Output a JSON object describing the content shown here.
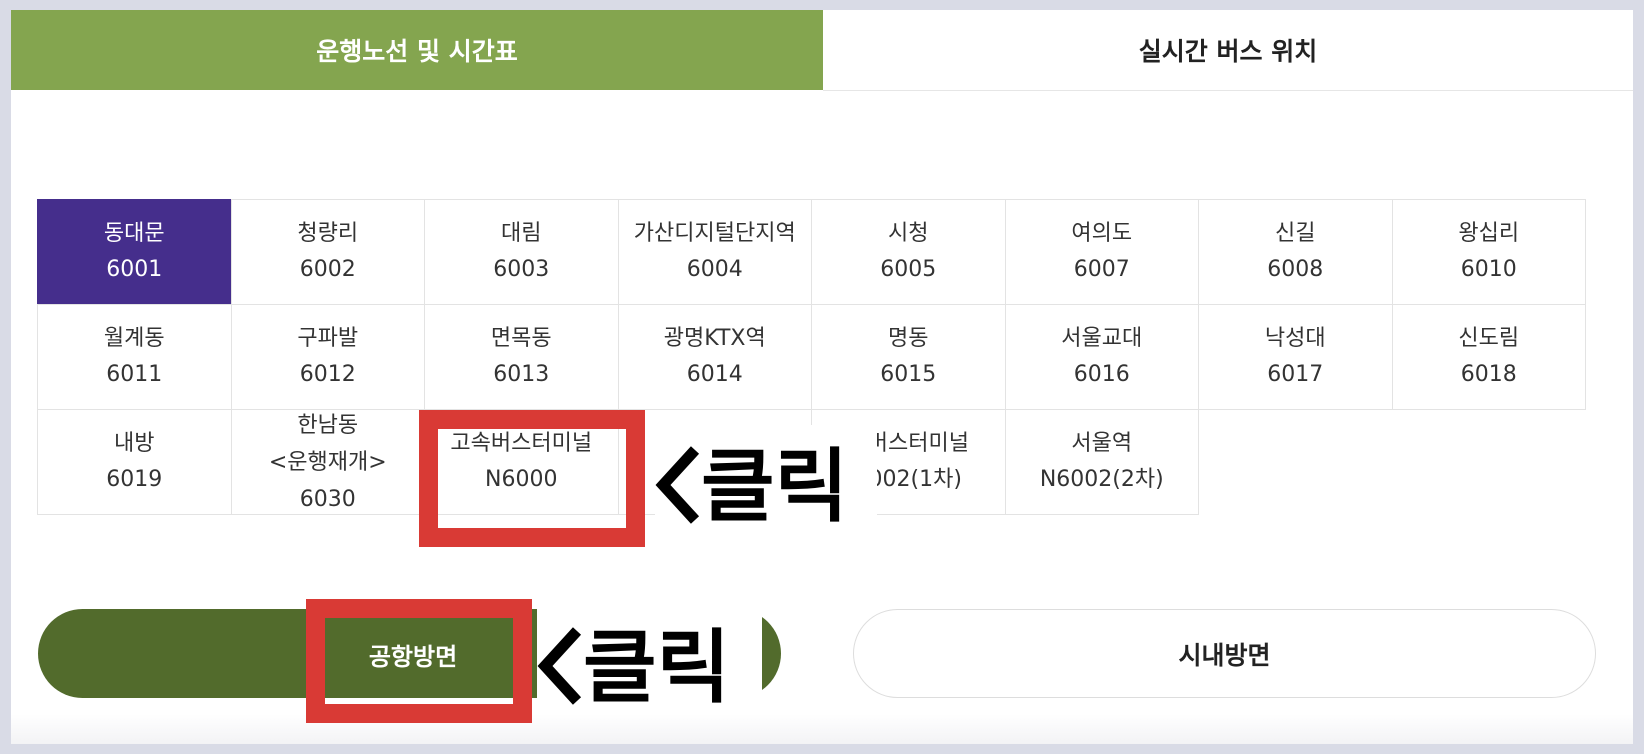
{
  "tabs": [
    {
      "label": "운행노선 및 시간표",
      "active": true
    },
    {
      "label": "실시간 버스 위치",
      "active": false
    }
  ],
  "routes": [
    {
      "name": "동대문",
      "number": "6001",
      "selected": true
    },
    {
      "name": "청량리",
      "number": "6002"
    },
    {
      "name": "대림",
      "number": "6003"
    },
    {
      "name": "가산디지털단지역",
      "number": "6004"
    },
    {
      "name": "시청",
      "number": "6005"
    },
    {
      "name": "여의도",
      "number": "6007"
    },
    {
      "name": "신길",
      "number": "6008"
    },
    {
      "name": "왕십리",
      "number": "6010"
    },
    {
      "name": "월계동",
      "number": "6011"
    },
    {
      "name": "구파발",
      "number": "6012"
    },
    {
      "name": "면목동",
      "number": "6013"
    },
    {
      "name": "광명KTX역",
      "number": "6014"
    },
    {
      "name": "명동",
      "number": "6015"
    },
    {
      "name": "서울교대",
      "number": "6016"
    },
    {
      "name": "낙성대",
      "number": "6017"
    },
    {
      "name": "신도림",
      "number": "6018"
    },
    {
      "name": "내방",
      "number": "6019"
    },
    {
      "name": "한남동",
      "note": "<운행재개>",
      "number": "6030"
    },
    {
      "name": "고속버스터미널",
      "number": "N6000"
    },
    {
      "name": "",
      "number": ""
    },
    {
      "name": "속버스터미널",
      "number": "6002(1차)"
    },
    {
      "name": "서울역",
      "number": "N6002(2차)"
    }
  ],
  "directions": {
    "airport": "공항방면",
    "city": "시내방면"
  },
  "annotations": {
    "click_text": "클릭",
    "highlight_color": "#d93a35"
  },
  "colors": {
    "tab_active": "#84a54f",
    "route_selected": "#452e8c",
    "direction_active": "#526b2c"
  }
}
